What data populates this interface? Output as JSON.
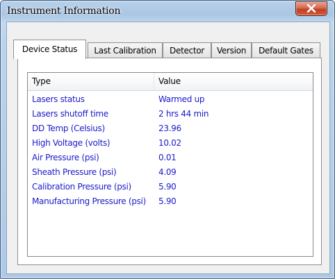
{
  "window": {
    "title": "Instrument Information",
    "close_glyph": "X"
  },
  "tabs": [
    {
      "label": "Device Status",
      "active": true
    },
    {
      "label": "Last Calibration",
      "active": false
    },
    {
      "label": "Detector",
      "active": false
    },
    {
      "label": "Version",
      "active": false
    },
    {
      "label": "Default Gates",
      "active": false
    }
  ],
  "list": {
    "columns": [
      "Type",
      "Value"
    ],
    "rows": [
      {
        "type": "Lasers status",
        "value": "Warmed up"
      },
      {
        "type": "Lasers shutoff time",
        "value": "2 hrs 44 min"
      },
      {
        "type": "DD Temp (Celsius)",
        "value": "23.96"
      },
      {
        "type": "High Voltage (volts)",
        "value": "10.02"
      },
      {
        "type": "Air Pressure (psi)",
        "value": "0.01"
      },
      {
        "type": "Sheath Pressure (psi)",
        "value": "4.09"
      },
      {
        "type": "Calibration Pressure (psi)",
        "value": "5.90"
      },
      {
        "type": "Manufacturing Pressure (psi)",
        "value": "5.90"
      }
    ]
  },
  "colors": {
    "row_text": "#1a1acc",
    "close_button": "#c13f22",
    "frame": "#b9d1ea"
  }
}
